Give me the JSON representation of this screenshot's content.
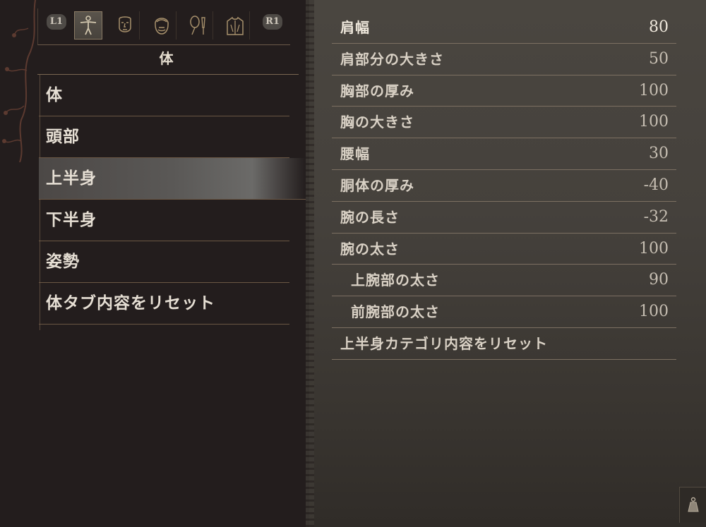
{
  "header": {
    "badge_left": "L1",
    "badge_right": "R1",
    "tabs": [
      {
        "icon": "body-figure-icon",
        "active": true
      },
      {
        "icon": "face-icon",
        "active": false
      },
      {
        "icon": "hair-head-icon",
        "active": false
      },
      {
        "icon": "makeup-brush-icon",
        "active": false
      },
      {
        "icon": "torso-clothing-icon",
        "active": false
      }
    ],
    "title": "体"
  },
  "menu": {
    "items": [
      {
        "label": "体",
        "selected": false
      },
      {
        "label": "頭部",
        "selected": false
      },
      {
        "label": "上半身",
        "selected": true
      },
      {
        "label": "下半身",
        "selected": false
      },
      {
        "label": "姿勢",
        "selected": false
      },
      {
        "label": "体タブ内容をリセット",
        "selected": false
      }
    ]
  },
  "stats": {
    "rows": [
      {
        "name": "肩幅",
        "value": "80",
        "indent": false
      },
      {
        "name": "肩部分の大きさ",
        "value": "50",
        "indent": false
      },
      {
        "name": "胸部の厚み",
        "value": "100",
        "indent": false
      },
      {
        "name": "胸の大きさ",
        "value": "100",
        "indent": false
      },
      {
        "name": "腰幅",
        "value": "30",
        "indent": false
      },
      {
        "name": "胴体の厚み",
        "value": "-40",
        "indent": false
      },
      {
        "name": "腕の長さ",
        "value": "-32",
        "indent": false
      },
      {
        "name": "腕の太さ",
        "value": "100",
        "indent": false
      },
      {
        "name": "上腕部の太さ",
        "value": "90",
        "indent": true
      },
      {
        "name": "前腕部の太さ",
        "value": "100",
        "indent": true
      },
      {
        "name": "上半身カテゴリ内容をリセット",
        "value": "",
        "indent": false
      }
    ]
  },
  "corner_icon": "bell-icon",
  "colors": {
    "background": "#231d1d",
    "panel": "#45413c",
    "text": "#e6dfd4",
    "divider": "#6b5744",
    "selected_highlight": "#5a5856"
  }
}
